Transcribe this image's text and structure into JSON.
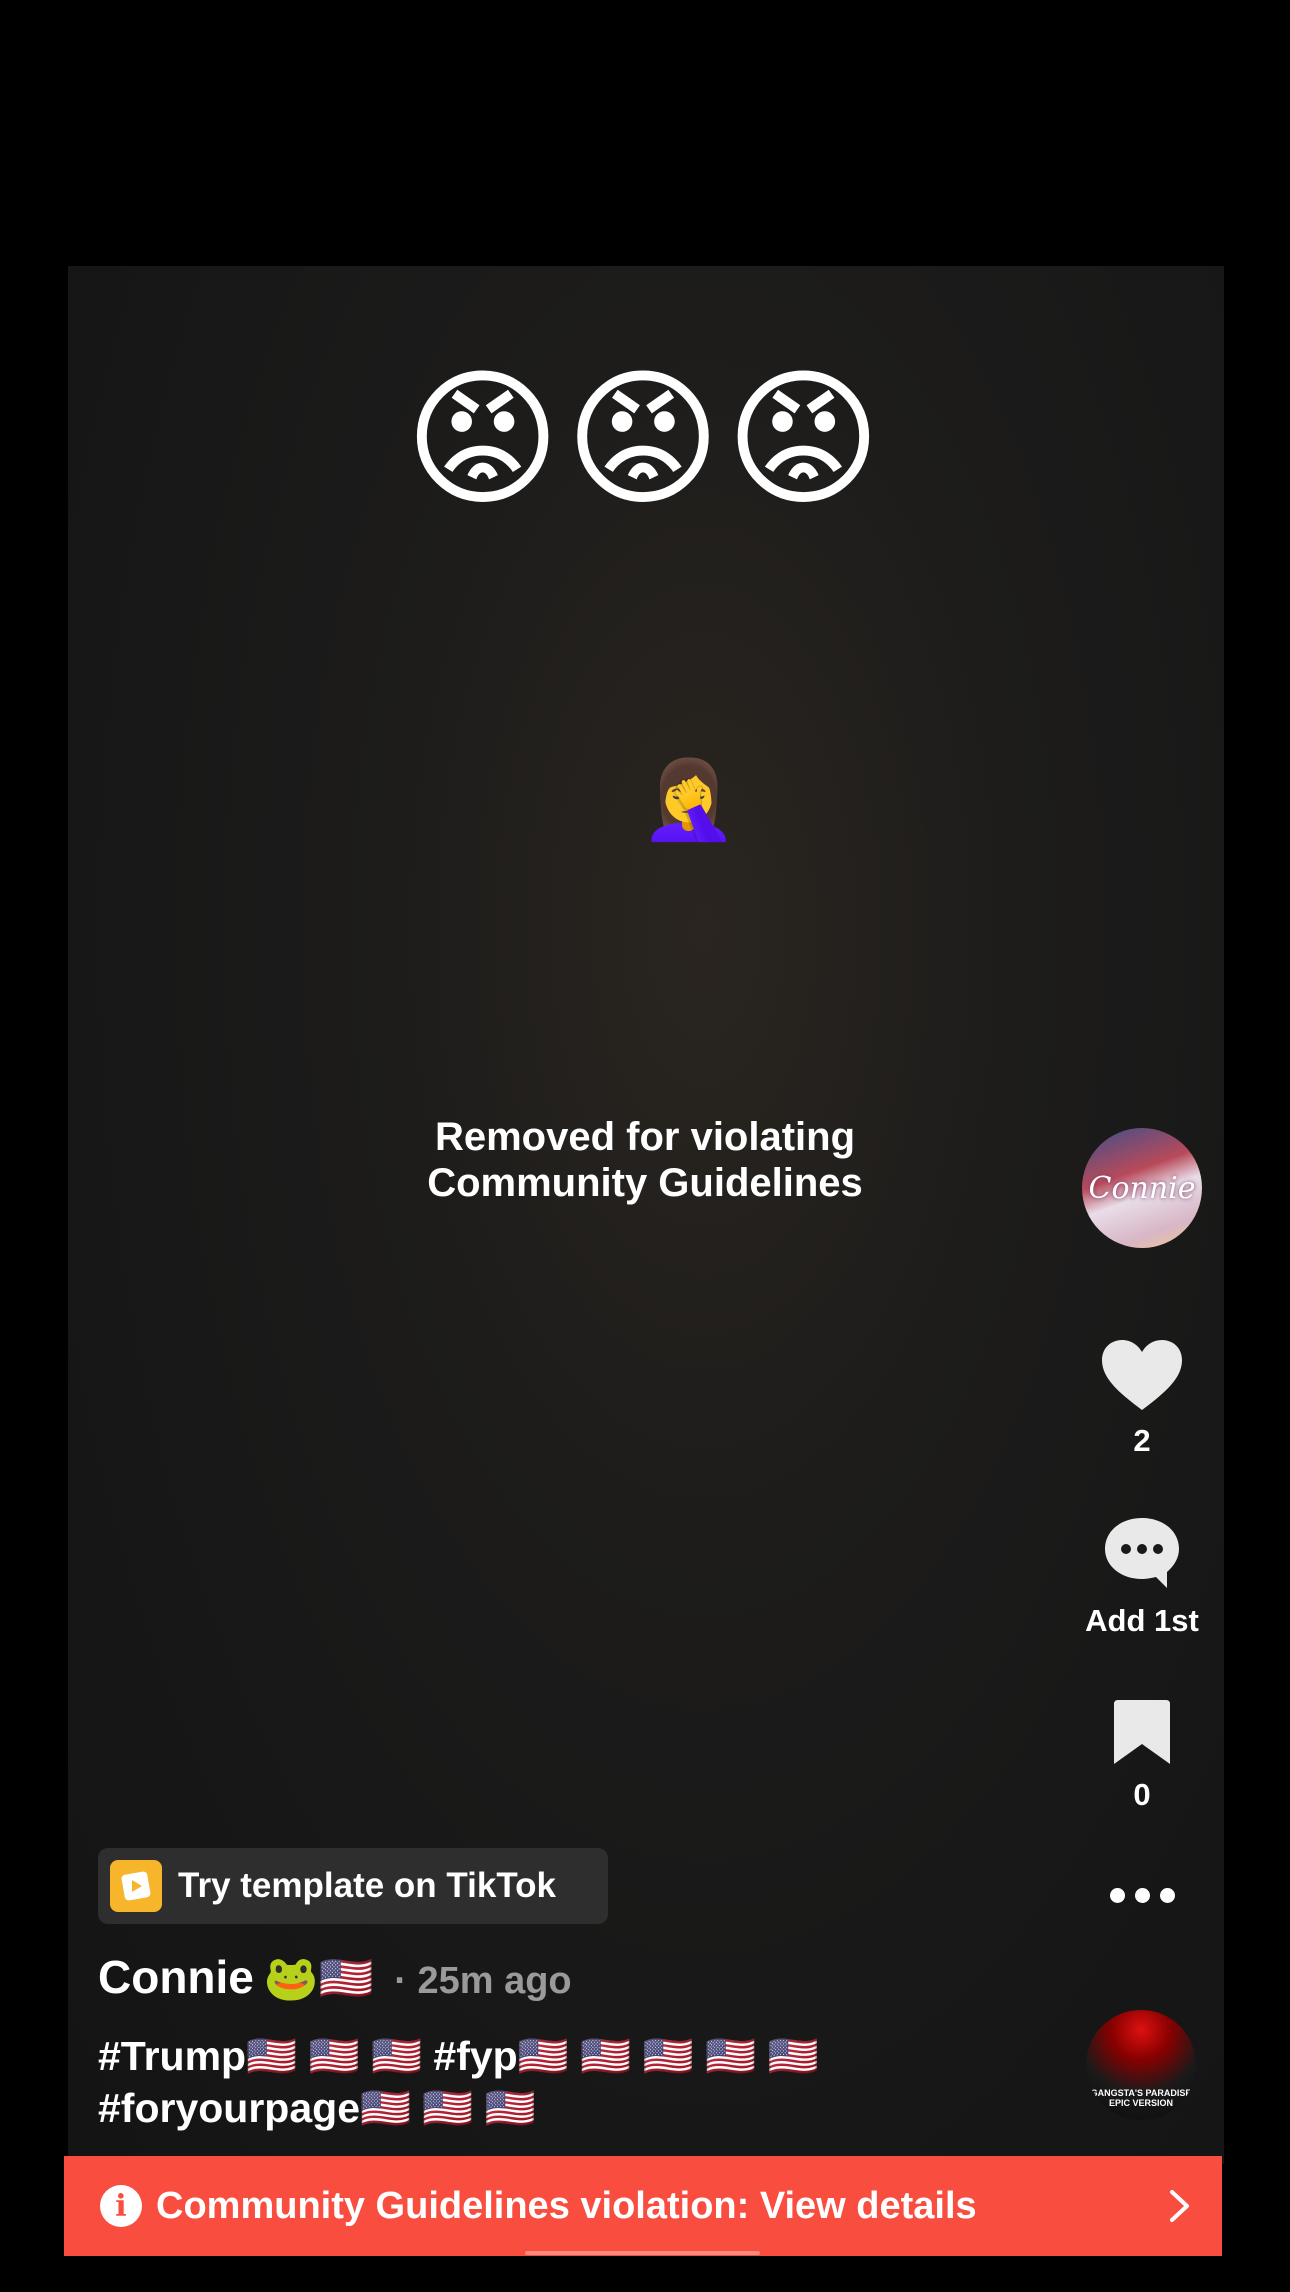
{
  "video": {
    "top_emojis": "😡😡😡",
    "sticker_emoji": "🤦‍♀️",
    "removed_line1": "Removed for violating",
    "removed_line2": "Community Guidelines"
  },
  "rail": {
    "avatar_text": "Connie",
    "like_count": "2",
    "comment_label": "Add 1st",
    "save_count": "0",
    "music_text": "GANGSTA'S PARADISE EPIC VERSION"
  },
  "template": {
    "label": "Try template on TikTok"
  },
  "author": {
    "name": "Connie",
    "emojis": "🐸🇺🇸",
    "time": "· 25m ago"
  },
  "caption": {
    "line1": "#Trump🇺🇸 🇺🇸 🇺🇸 #fyp🇺🇸 🇺🇸 🇺🇸 🇺🇸 🇺🇸",
    "line2": "#foryourpage🇺🇸 🇺🇸 🇺🇸"
  },
  "banner": {
    "text": "Community Guidelines violation: View details"
  },
  "colors": {
    "banner": "#f84d3f",
    "template_icon": "#f7b52b",
    "background": "#000000"
  }
}
